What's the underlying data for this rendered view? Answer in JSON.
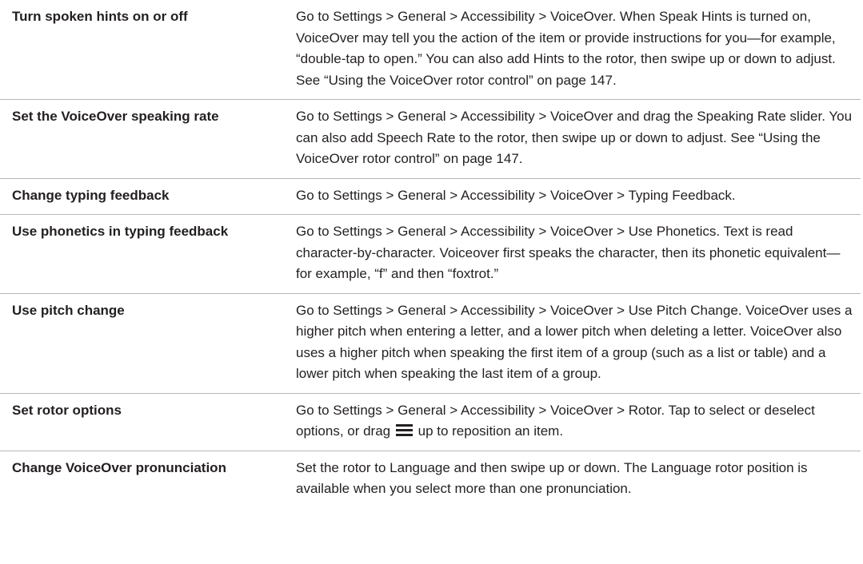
{
  "rows": [
    {
      "label": "Turn spoken hints on or off",
      "description": "Go to Settings > General > Accessibility > VoiceOver. When Speak Hints is turned on, VoiceOver may tell you the action of the item or provide instructions for you—for example, “double-tap to open.” You can also add Hints to the rotor, then swipe up or down to adjust. See “Using the VoiceOver rotor control” on page 147."
    },
    {
      "label": "Set the VoiceOver speaking rate",
      "description": "Go to Settings > General > Accessibility > VoiceOver and drag the Speaking Rate slider. You can also add Speech Rate to the rotor, then swipe up or down to adjust. See “Using the VoiceOver rotor control” on page 147."
    },
    {
      "label": "Change typing feedback",
      "description": "Go to Settings > General > Accessibility > VoiceOver > Typing Feedback."
    },
    {
      "label": "Use phonetics in typing feedback",
      "description": "Go to Settings > General > Accessibility > VoiceOver > Use Phonetics. Text is read character-by-character. Voiceover first speaks the character, then its phonetic equivalent—for example, “f” and then “foxtrot.”"
    },
    {
      "label": "Use pitch change",
      "description": "Go to Settings > General > Accessibility > VoiceOver > Use Pitch Change. VoiceOver uses a higher pitch when entering a letter, and a lower pitch when deleting a letter. VoiceOver also uses a higher pitch when speaking the first item of a group (such as a list or table) and a lower pitch when speaking the last item of a group."
    },
    {
      "label": "Set rotor options",
      "description_before_icon": "Go to Settings > General > Accessibility > VoiceOver > Rotor. Tap to select or deselect options, or drag",
      "icon": "reorder-handle-icon",
      "description_after_icon": "up to reposition an item."
    },
    {
      "label": "Change VoiceOver pronunciation",
      "description": "Set the rotor to Language and then swipe up or down. The Language rotor position is available when you select more than one pronunciation."
    }
  ]
}
